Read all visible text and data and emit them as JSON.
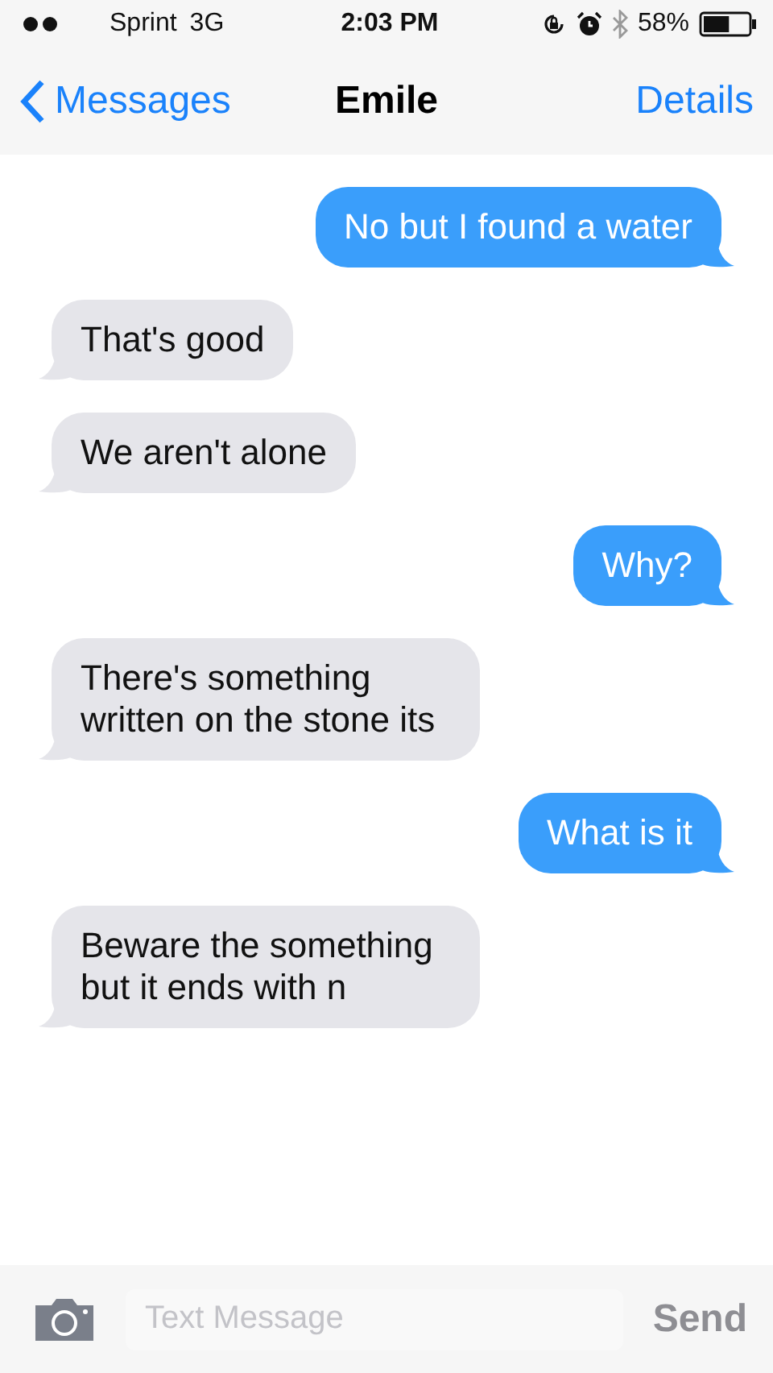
{
  "status_bar": {
    "carrier": "Sprint",
    "network": "3G",
    "time": "2:03 PM",
    "battery": "58%"
  },
  "nav": {
    "back": "Messages",
    "title": "Emile",
    "action": "Details"
  },
  "messages": [
    {
      "kind": "sent",
      "text": "No but I found a water"
    },
    {
      "kind": "received",
      "text": "That's good"
    },
    {
      "kind": "received",
      "text": "We aren't alone"
    },
    {
      "kind": "sent",
      "text": "Why?"
    },
    {
      "kind": "received",
      "text": "There's something written on the stone its"
    },
    {
      "kind": "sent",
      "text": "What is it"
    },
    {
      "kind": "received",
      "text": "Beware the something but it ends with n"
    }
  ],
  "composer": {
    "placeholder": "Text Message",
    "send": "Send",
    "send_disabled": true
  }
}
